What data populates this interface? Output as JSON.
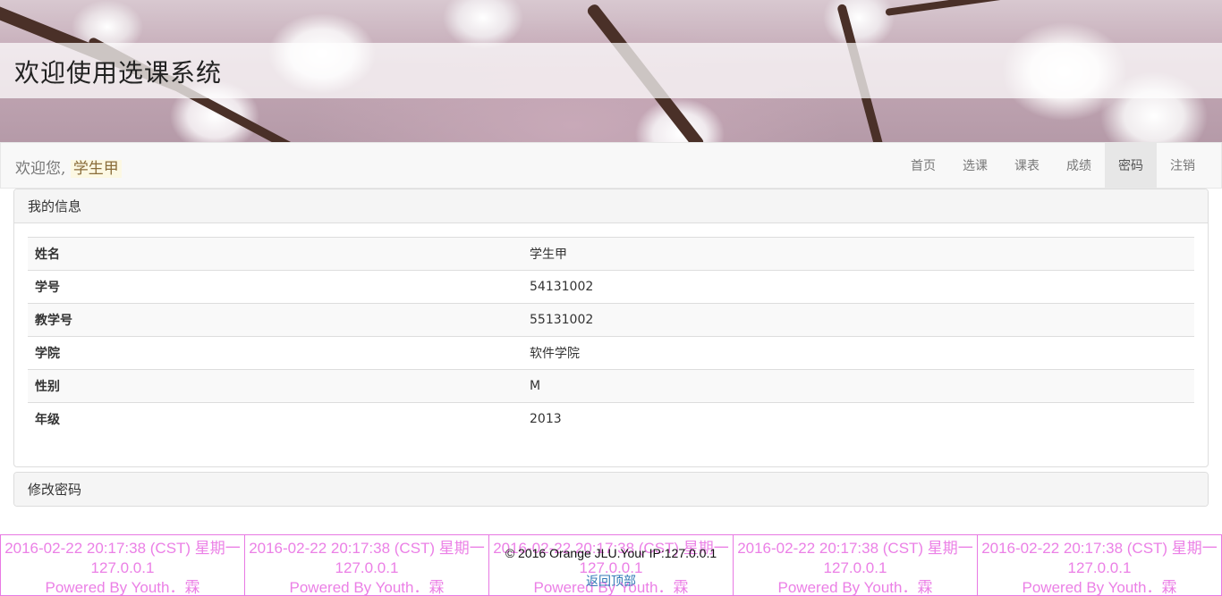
{
  "header": {
    "title": "欢迎使用选课系统"
  },
  "navbar": {
    "welcome_prefix": "欢迎您,",
    "username": "学生甲",
    "items": [
      {
        "label": "首页"
      },
      {
        "label": "选课"
      },
      {
        "label": "课表"
      },
      {
        "label": "成绩"
      },
      {
        "label": "密码",
        "active": true
      },
      {
        "label": "注销"
      }
    ]
  },
  "info_panel": {
    "heading": "我的信息",
    "rows": [
      {
        "key": "姓名",
        "value": "学生甲"
      },
      {
        "key": "学号",
        "value": "54131002"
      },
      {
        "key": "教学号",
        "value": "55131002"
      },
      {
        "key": "学院",
        "value": "软件学院"
      },
      {
        "key": "性别",
        "value": "M"
      },
      {
        "key": "年级",
        "value": "2013"
      }
    ]
  },
  "password_panel": {
    "heading": "修改密码"
  },
  "watermark": {
    "line1": "2016-02-22 20:17:38 (CST) 星期一",
    "line2": "127.0.0.1",
    "line3": "Powered By Youth．霖"
  },
  "footer": {
    "copyright": "© 2016 Orange JLU.Your IP:127.0.0.1",
    "back_to_top": "返回顶部"
  },
  "colors": {
    "watermark": "#eb80e6",
    "link": "#337ab7",
    "active_nav": "#e7e7e7"
  }
}
